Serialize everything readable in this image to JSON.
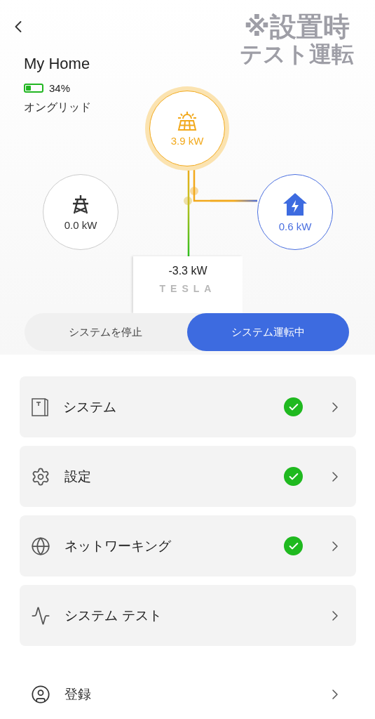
{
  "header": {
    "title": "My Home",
    "battery": {
      "percent": "34%"
    },
    "status": "オングリッド"
  },
  "annotation": {
    "line1": "※設置時",
    "line2": "テスト運転"
  },
  "flow": {
    "solar": {
      "reading": "3.9 kW"
    },
    "grid": {
      "reading": "0.0 kW"
    },
    "home": {
      "reading": "0.6 kW"
    },
    "powerwall": {
      "reading": "-3.3 kW",
      "logo": "TESLA"
    }
  },
  "mode_toggle": [
    {
      "label": "システムを停止",
      "selected": false
    },
    {
      "label": "システム運転中",
      "selected": true
    }
  ],
  "menu": [
    {
      "label": "システム",
      "checked": true,
      "kind": "card"
    },
    {
      "label": "設定",
      "checked": true,
      "kind": "card"
    },
    {
      "label": "ネットワーキング",
      "checked": true,
      "kind": "card"
    },
    {
      "label": "システム テスト",
      "checked": false,
      "kind": "card"
    },
    {
      "label": "登録",
      "checked": false,
      "kind": "plain"
    }
  ]
}
